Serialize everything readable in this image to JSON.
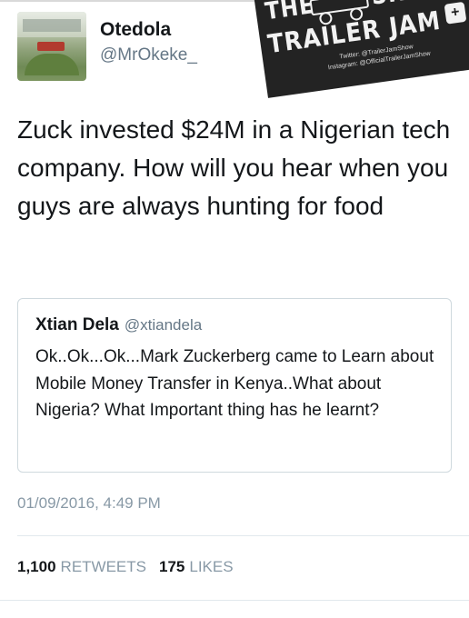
{
  "author": {
    "name": "Otedola",
    "handle": "@MrOkeke_"
  },
  "tweet": {
    "text": "Zuck invested $24M in a Nigerian tech company. How will you hear when you guys are always hunting for food"
  },
  "quoted_tweet": {
    "name": "Xtian Dela",
    "handle": "@xtiandela",
    "text": "Ok..Ok...Ok...Mark Zuckerberg came to Learn about Mobile Money Transfer in Kenya..What about Nigeria? What Important thing has he learnt?"
  },
  "meta": {
    "timestamp": "01/09/2016, 4:49 PM"
  },
  "stats": {
    "retweets_count": "1,100",
    "retweets_label": "RETWEETS",
    "likes_count": "175",
    "likes_label": "LIKES"
  },
  "watermark": {
    "word_the": "THE",
    "word_show": "SHOW",
    "main": "TRAILER JAM",
    "twitter_line": "Twitter: @TrailerJamShow",
    "instagram_line": "Instagram: @OfficialTrailerJamShow",
    "badge": "+"
  },
  "colors": {
    "text": "#14171a",
    "secondary": "#657786",
    "muted": "#8899a6",
    "border": "#cfd9de"
  }
}
